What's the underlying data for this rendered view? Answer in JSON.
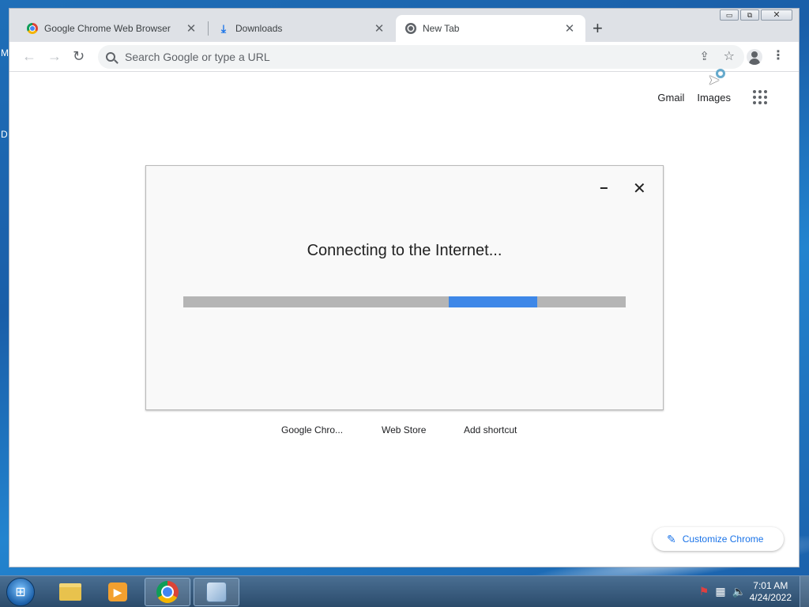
{
  "desktop": {
    "left_letter_1": "M",
    "left_letter_2": "D"
  },
  "tabs": [
    {
      "title": "Google Chrome Web Browser",
      "close": "✕",
      "favicon": "chrome-icon"
    },
    {
      "title": "Downloads",
      "close": "✕",
      "favicon": "download-icon"
    },
    {
      "title": "New Tab",
      "close": "✕",
      "favicon": "chrome-gray-icon"
    }
  ],
  "new_tab_symbol": "+",
  "window_controls": {
    "minimize": "▭",
    "restore": "⧉",
    "close": "✕"
  },
  "toolbar": {
    "back": "←",
    "forward": "→",
    "reload": "↻",
    "omnibox_placeholder": "Search Google or type a URL",
    "share": "⇪",
    "star": "☆",
    "menu": "⋮"
  },
  "ntp": {
    "gmail": "Gmail",
    "images": "Images",
    "shortcuts": [
      "Google Chro...",
      "Web Store",
      "Add shortcut"
    ],
    "customize_label": "Customize Chrome",
    "customize_icon": "pencil-icon"
  },
  "dialog": {
    "minimize": "−",
    "close": "✕",
    "message": "Connecting to the Internet...",
    "progress_fill_start": 0.6,
    "progress_fill_end": 0.8,
    "progress_color": "#3e88e8"
  },
  "taskbar": {
    "start_icon": "windows-start-icon",
    "items": [
      "file-explorer-icon",
      "media-player-icon",
      "chrome-icon",
      "installer-icon"
    ],
    "clock_time": "7:01 AM",
    "clock_date": "4/24/2022"
  }
}
